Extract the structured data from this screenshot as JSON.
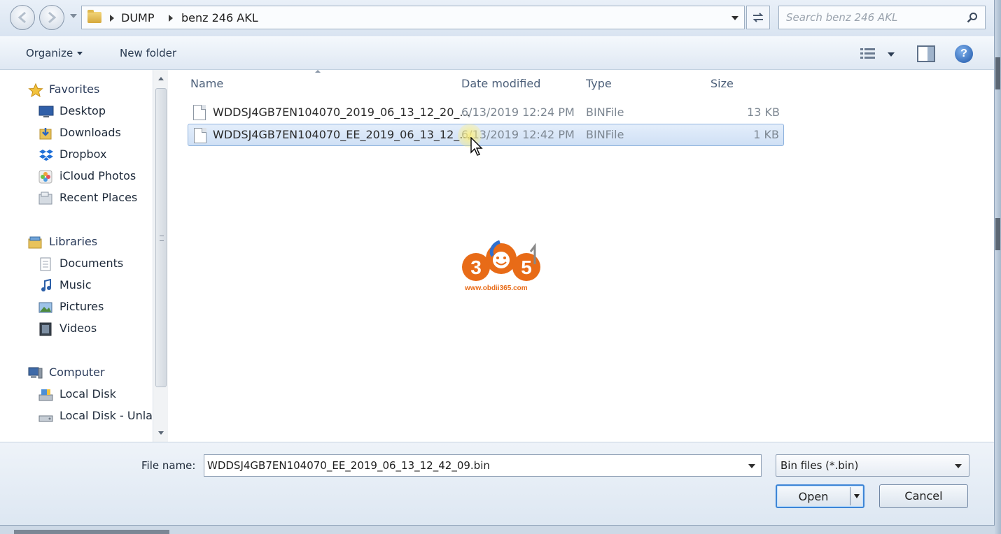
{
  "address": {
    "crumbs": [
      "DUMP",
      "benz 246 AKL"
    ],
    "search_placeholder": "Search benz 246 AKL"
  },
  "toolbar": {
    "organize_label": "Organize",
    "new_folder_label": "New folder",
    "help_glyph": "?"
  },
  "nav": {
    "favorites": {
      "label": "Favorites",
      "items": [
        "Desktop",
        "Downloads",
        "Dropbox",
        "iCloud Photos",
        "Recent Places"
      ]
    },
    "libraries": {
      "label": "Libraries",
      "items": [
        "Documents",
        "Music",
        "Pictures",
        "Videos"
      ]
    },
    "computer": {
      "label": "Computer",
      "items": [
        "Local Disk",
        "Local Disk - Unla"
      ]
    }
  },
  "columns": {
    "name": "Name",
    "date_modified": "Date modified",
    "type": "Type",
    "size": "Size"
  },
  "files": [
    {
      "name": "WDDSJ4GB7EN104070_2019_06_13_12_20_...",
      "date": "6/13/2019 12:24 PM",
      "type": "BINFile",
      "size": "13 KB",
      "selected": false
    },
    {
      "name": "WDDSJ4GB7EN104070_EE_2019_06_13_12_...",
      "date": "6/13/2019 12:42 PM",
      "type": "BINFile",
      "size": "1 KB",
      "selected": true
    }
  ],
  "watermark": {
    "digits": "365",
    "url": "www.obdii365.com"
  },
  "footer": {
    "file_name_label": "File name:",
    "file_name_value": "WDDSJ4GB7EN104070_EE_2019_06_13_12_42_09.bin",
    "file_type_value": "Bin files (*.bin)",
    "open_label": "Open",
    "cancel_label": "Cancel"
  },
  "colors": {
    "selection": "#cfe0f5",
    "accent": "#3d85d6",
    "logo_orange": "#e86b17"
  }
}
